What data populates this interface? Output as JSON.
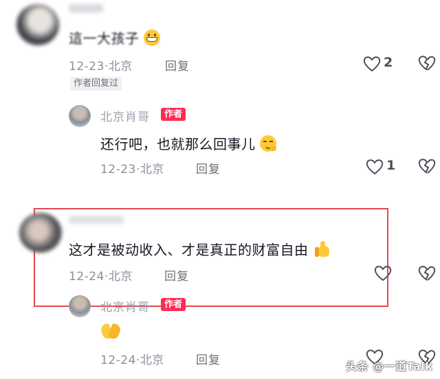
{
  "comments": [
    {
      "id": "c1",
      "author": "",
      "text": "這一大孩子",
      "emoji": "grinning-face",
      "date": "12-23",
      "location": "北京",
      "reply_label": "回复",
      "likes": "2",
      "badge": "作者回复过"
    },
    {
      "id": "c1-reply",
      "author": "北京肖哥",
      "author_badge": "作者",
      "text": "还行吧，也就那么回事儿",
      "emoji": "smirking-face",
      "date": "12-23",
      "location": "北京",
      "reply_label": "回复",
      "likes": "1"
    },
    {
      "id": "c2",
      "author": "",
      "text": "这才是被动收入、才是真正的财富自由",
      "emoji": "thumbs-up",
      "date": "12-24",
      "location": "北京",
      "reply_label": "回复",
      "likes": ""
    },
    {
      "id": "c2-reply",
      "author": "北京肖哥",
      "author_badge": "作者",
      "text": "",
      "emoji": "pray-hands",
      "date": "12-24",
      "location": "北京",
      "reply_label": "回复",
      "likes": ""
    }
  ],
  "separator": "·",
  "watermark": "头条 @一道Talk",
  "colors": {
    "highlight": "#e8464b",
    "author_badge": "#fe2c55",
    "text": "#161823",
    "meta": "#8a8f99"
  }
}
